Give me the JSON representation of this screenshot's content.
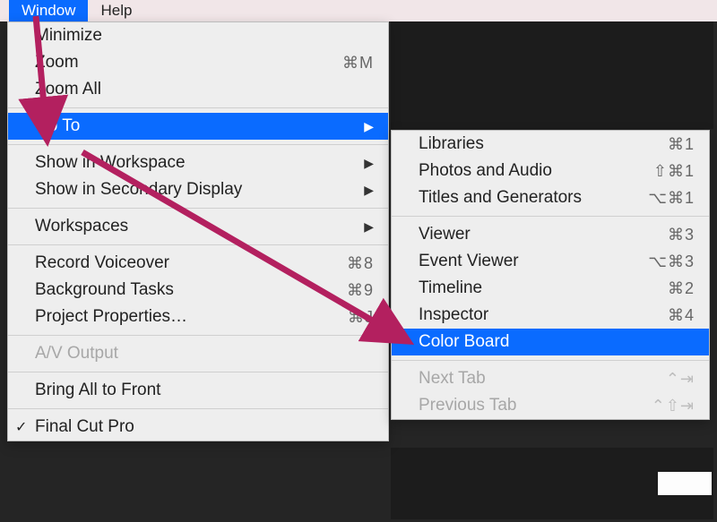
{
  "menubar": {
    "window": "Window",
    "help": "Help"
  },
  "main_menu": {
    "minimize": "Minimize",
    "zoom": "Zoom",
    "zoom_shortcut": "⌘M",
    "zoom_all": "Zoom All",
    "go_to": "Go To",
    "show_workspace": "Show in Workspace",
    "show_secondary": "Show in Secondary Display",
    "workspaces": "Workspaces",
    "record_voiceover": "Record Voiceover",
    "record_voiceover_shortcut": "⌘8",
    "background_tasks": "Background Tasks",
    "background_tasks_shortcut": "⌘9",
    "project_properties": "Project Properties…",
    "project_properties_shortcut": "⌘J",
    "av_output": "A/V Output",
    "bring_all_front": "Bring All to Front",
    "final_cut_pro": "Final Cut Pro"
  },
  "sub_menu": {
    "libraries": "Libraries",
    "libraries_shortcut": "⌘1",
    "photos_audio": "Photos and Audio",
    "photos_audio_shortcut": "⇧⌘1",
    "titles_generators": "Titles and Generators",
    "titles_generators_shortcut": "⌥⌘1",
    "viewer": "Viewer",
    "viewer_shortcut": "⌘3",
    "event_viewer": "Event Viewer",
    "event_viewer_shortcut": "⌥⌘3",
    "timeline": "Timeline",
    "timeline_shortcut": "⌘2",
    "inspector": "Inspector",
    "inspector_shortcut": "⌘4",
    "color_board": "Color Board",
    "next_tab": "Next Tab",
    "next_tab_shortcut": "⌃⇥",
    "previous_tab": "Previous Tab",
    "previous_tab_shortcut": "⌃⇧⇥"
  },
  "annotation": {
    "arrow_color": "#b3205f"
  }
}
